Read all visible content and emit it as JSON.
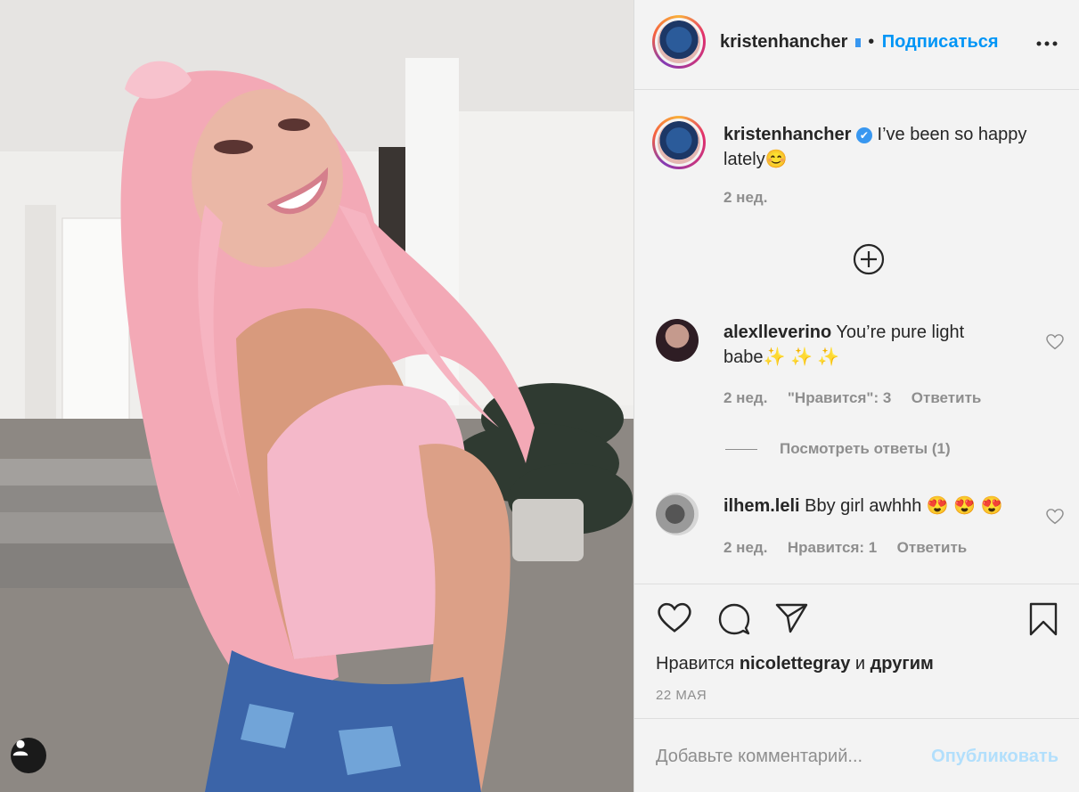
{
  "post": {
    "username": "kristenhancher",
    "follow_label": "Подписаться",
    "more_icon": "more-horizontal-icon",
    "verified_icon": "verified-badge-icon"
  },
  "caption": {
    "username": "kristenhancher",
    "text_line1": "I’ve been so happy",
    "text_line2": "lately😊",
    "time": "2 нед."
  },
  "load_more_icon": "plus-circle-icon",
  "comments": [
    {
      "username": "alexlleverino",
      "text_line1": "You’re pure light",
      "text_line2": "babe✨ ✨ ✨",
      "time": "2 нед.",
      "likes": "\"Нравится\": 3",
      "reply": "Ответить",
      "view_replies": "Посмотреть ответы (1)"
    },
    {
      "username": "ilhem.leli",
      "text": "Bby girl awhhh 😍 😍 😍",
      "time": "2 нед.",
      "likes": "Нравится: 1",
      "reply": "Ответить"
    }
  ],
  "actions": {
    "likes_prefix": "Нравится",
    "likes_user": "nicolettegray",
    "likes_joiner": "и",
    "likes_others": "другим",
    "date": "22 МАЯ"
  },
  "comment_box": {
    "placeholder": "Добавьте комментарий...",
    "publish_label": "Опубликовать"
  },
  "colors": {
    "accent": "#0095f6",
    "publish_disabled": "#b2dffc",
    "text": "#262626",
    "muted": "#8e8e8e"
  }
}
